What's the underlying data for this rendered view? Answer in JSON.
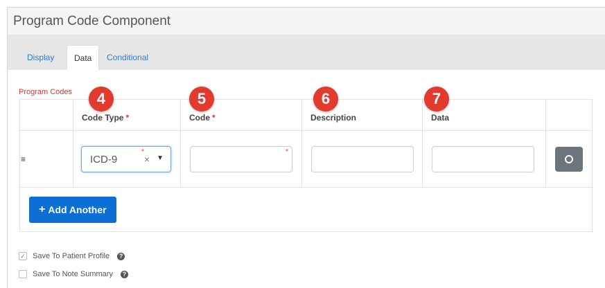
{
  "header": {
    "title": "Program Code Component"
  },
  "tabs": [
    {
      "label": "Display",
      "active": false
    },
    {
      "label": "Data",
      "active": true
    },
    {
      "label": "Conditional",
      "active": false
    }
  ],
  "section": {
    "label": "Program Codes"
  },
  "table": {
    "columns": [
      "Code Type",
      "Code",
      "Description",
      "Data"
    ],
    "row": {
      "handle_icon": "drag-handle-icon",
      "code_type_value": "ICD-9",
      "clear_glyph": "×",
      "caret_glyph": "▼",
      "required_mark": "*",
      "code_value": "",
      "description_value": "",
      "data_value": ""
    }
  },
  "add_button": {
    "label": "Add Another",
    "icon": "+"
  },
  "badges": [
    "4",
    "5",
    "6",
    "7"
  ],
  "checkboxes": [
    {
      "label": "Save To Patient Profile",
      "checked": true
    },
    {
      "label": "Save To Note Summary",
      "checked": false
    }
  ],
  "colors": {
    "accent": "#0b6fd6",
    "required": "#e0342a",
    "badge": "#e43a2d"
  }
}
